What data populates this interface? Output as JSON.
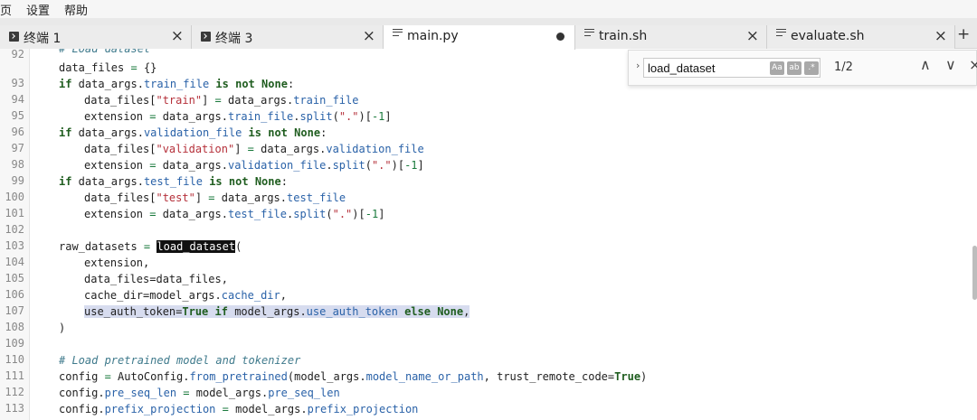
{
  "menu": {
    "items": [
      "页",
      "设置",
      "帮助"
    ]
  },
  "tabs": [
    {
      "label": "终端 1",
      "icon": "terminal-icon",
      "close": "×"
    },
    {
      "label": "终端 3",
      "icon": "terminal-icon",
      "close": "×"
    },
    {
      "label": "main.py",
      "icon": "file-icon",
      "modified": true
    },
    {
      "label": "train.sh",
      "icon": "file-icon",
      "close": "×"
    },
    {
      "label": "evaluate.sh",
      "icon": "file-icon",
      "close": "×"
    }
  ],
  "tab_add": "+",
  "find": {
    "toggle": "›",
    "query": "load_dataset",
    "match_case": "Aa",
    "whole_word": "ab",
    "regex": ".*",
    "count": "1/2",
    "prev": "∧",
    "next": "∨",
    "close": "×"
  },
  "editor": {
    "partial_top": "# Load dataset",
    "lines": [
      {
        "no": "92",
        "code": "data_files = {}"
      },
      {
        "no": "93",
        "code": "if data_args.train_file is not None:"
      },
      {
        "no": "94",
        "code": "data_files[\"train\"] = data_args.train_file"
      },
      {
        "no": "95",
        "code": "extension = data_args.train_file.split(\".\")[-1]"
      },
      {
        "no": "96",
        "code": "if data_args.validation_file is not None:"
      },
      {
        "no": "97",
        "code": "data_files[\"validation\"] = data_args.validation_file"
      },
      {
        "no": "98",
        "code": "extension = data_args.validation_file.split(\".\")[-1]"
      },
      {
        "no": "99",
        "code": "if data_args.test_file is not None:"
      },
      {
        "no": "100",
        "code": "data_files[\"test\"] = data_args.test_file"
      },
      {
        "no": "101",
        "code": "extension = data_args.test_file.split(\".\")[-1]"
      },
      {
        "no": "102",
        "code": ""
      },
      {
        "no": "103",
        "code": "raw_datasets = load_dataset("
      },
      {
        "no": "104",
        "code": "extension,"
      },
      {
        "no": "105",
        "code": "data_files=data_files,"
      },
      {
        "no": "106",
        "code": "cache_dir=model_args.cache_dir,"
      },
      {
        "no": "107",
        "code": "use_auth_token=True if model_args.use_auth_token else None,"
      },
      {
        "no": "108",
        "code": ")"
      },
      {
        "no": "109",
        "code": ""
      },
      {
        "no": "110",
        "code": "# Load pretrained model and tokenizer"
      },
      {
        "no": "111",
        "code": "config = AutoConfig.from_pretrained(model_args.model_name_or_path, trust_remote_code=True)"
      },
      {
        "no": "112",
        "code": "config.pre_seq_len = model_args.pre_seq_len"
      },
      {
        "no": "113",
        "code": "config.prefix_projection = model_args.prefix_projection"
      }
    ]
  },
  "colors": {
    "keyword": "#1f5d1f",
    "string": "#b5303a",
    "number": "#1a7a3c",
    "attribute": "#2a62a8",
    "comment": "#3f7a8c",
    "selection": "#d7dcef",
    "match": "#111111"
  }
}
